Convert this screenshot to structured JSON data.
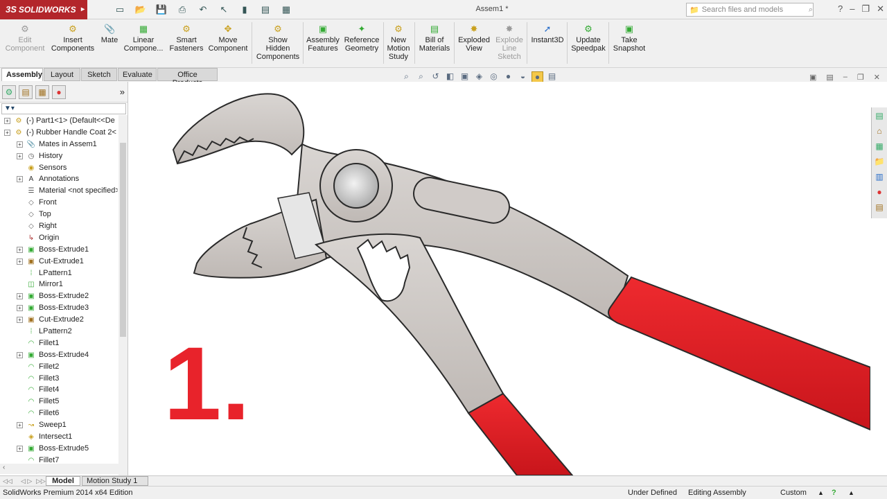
{
  "app": {
    "brand": "SOLIDWORKS",
    "doc_title": "Assem1 *"
  },
  "search": {
    "placeholder": "Search files and models"
  },
  "ribbon": {
    "edit_component": "Edit\nComponent",
    "insert_components": "Insert\nComponents",
    "mate": "Mate",
    "linear_component": "Linear\nCompone...",
    "smart_fasteners": "Smart\nFasteners",
    "move_component": "Move\nComponent",
    "show_hidden": "Show\nHidden\nComponents",
    "assembly_features": "Assembly\nFeatures",
    "reference_geometry": "Reference\nGeometry",
    "new_motion_study": "New\nMotion\nStudy",
    "bill_of_materials": "Bill of\nMaterials",
    "exploded_view": "Exploded\nView",
    "explode_line_sketch": "Explode\nLine\nSketch",
    "instant3d": "Instant3D",
    "update_speedpak": "Update\nSpeedpak",
    "take_snapshot": "Take\nSnapshot"
  },
  "cm_tabs": [
    "Assembly",
    "Layout",
    "Sketch",
    "Evaluate",
    "Office Products"
  ],
  "tree": [
    {
      "label": "(-) Part1<1> (Default<<De",
      "icon": "part",
      "expand": true,
      "level": 0
    },
    {
      "label": "(-) Rubber Handle Coat 2<",
      "icon": "part",
      "expand": true,
      "level": 0
    },
    {
      "label": "Mates in Assem1",
      "icon": "mates",
      "expand": true,
      "level": 1
    },
    {
      "label": "History",
      "icon": "history",
      "expand": true,
      "level": 1
    },
    {
      "label": "Sensors",
      "icon": "sensor",
      "expand": false,
      "level": 1
    },
    {
      "label": "Annotations",
      "icon": "annotation",
      "expand": true,
      "level": 1
    },
    {
      "label": "Material <not specified>",
      "icon": "material",
      "expand": false,
      "level": 1
    },
    {
      "label": "Front",
      "icon": "plane",
      "expand": false,
      "level": 1
    },
    {
      "label": "Top",
      "icon": "plane",
      "expand": false,
      "level": 1
    },
    {
      "label": "Right",
      "icon": "plane",
      "expand": false,
      "level": 1
    },
    {
      "label": "Origin",
      "icon": "origin",
      "expand": false,
      "level": 1
    },
    {
      "label": "Boss-Extrude1",
      "icon": "boss",
      "expand": true,
      "level": 1
    },
    {
      "label": "Cut-Extrude1",
      "icon": "cut",
      "expand": true,
      "level": 1
    },
    {
      "label": "LPattern1",
      "icon": "pattern",
      "expand": false,
      "level": 1
    },
    {
      "label": "Mirror1",
      "icon": "mirror",
      "expand": false,
      "level": 1
    },
    {
      "label": "Boss-Extrude2",
      "icon": "boss",
      "expand": true,
      "level": 1
    },
    {
      "label": "Boss-Extrude3",
      "icon": "boss",
      "expand": true,
      "level": 1
    },
    {
      "label": "Cut-Extrude2",
      "icon": "cut",
      "expand": true,
      "level": 1
    },
    {
      "label": "LPattern2",
      "icon": "pattern",
      "expand": false,
      "level": 1
    },
    {
      "label": "Fillet1",
      "icon": "fillet",
      "expand": false,
      "level": 1
    },
    {
      "label": "Boss-Extrude4",
      "icon": "boss",
      "expand": true,
      "level": 1
    },
    {
      "label": "Fillet2",
      "icon": "fillet",
      "expand": false,
      "level": 1
    },
    {
      "label": "Fillet3",
      "icon": "fillet",
      "expand": false,
      "level": 1
    },
    {
      "label": "Fillet4",
      "icon": "fillet",
      "expand": false,
      "level": 1
    },
    {
      "label": "Fillet5",
      "icon": "fillet",
      "expand": false,
      "level": 1
    },
    {
      "label": "Fillet6",
      "icon": "fillet",
      "expand": false,
      "level": 1
    },
    {
      "label": "Sweep1",
      "icon": "sweep",
      "expand": true,
      "level": 1
    },
    {
      "label": "Intersect1",
      "icon": "intersect",
      "expand": false,
      "level": 1
    },
    {
      "label": "Boss-Extrude5",
      "icon": "boss",
      "expand": true,
      "level": 1
    },
    {
      "label": "Fillet7",
      "icon": "fillet",
      "expand": false,
      "level": 1
    }
  ],
  "overlay_number": "1.",
  "bottom_tabs": [
    "Model",
    "Motion Study 1"
  ],
  "status": {
    "edition": "SolidWorks Premium 2014 x64 Edition",
    "defined": "Under Defined",
    "mode": "Editing Assembly",
    "units": "Custom"
  },
  "colors": {
    "brand_red": "#b3262b",
    "handle_red": "#e01f26",
    "metal_grey": "#cdc8c4",
    "number_red": "#e8232b"
  }
}
